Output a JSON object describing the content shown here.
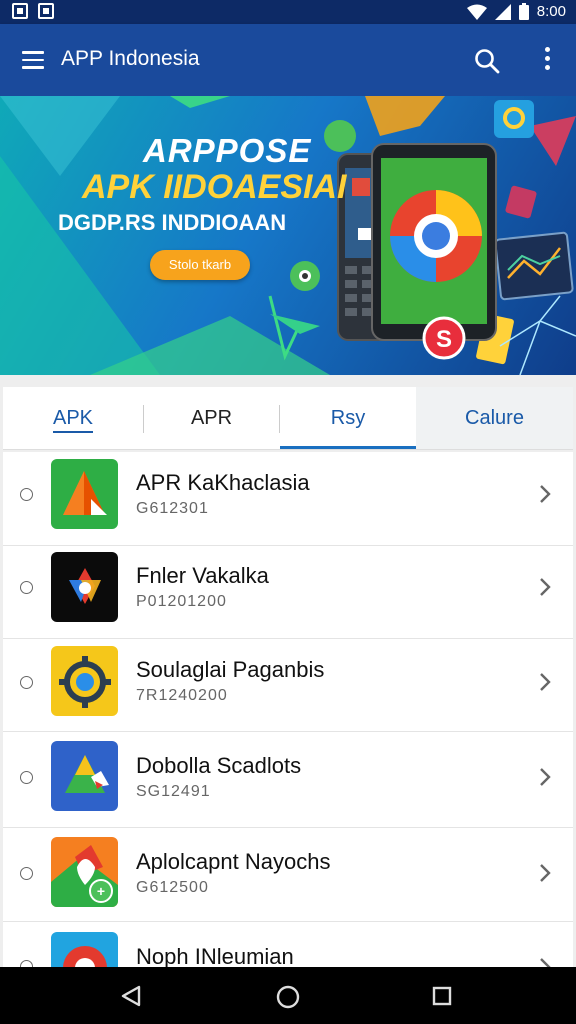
{
  "status_bar": {
    "time": "8:00"
  },
  "app_bar": {
    "title": "APP Indonesia"
  },
  "banner": {
    "line1": "ARPPOSE",
    "line2": "APK IIDOAESIAI",
    "line3": "DGDP.RS INDDIOAAN",
    "button_label": "Stolo tkarb"
  },
  "tabs": [
    {
      "label": "APK"
    },
    {
      "label": "APR"
    },
    {
      "label": "Rsy"
    },
    {
      "label": "Calure"
    }
  ],
  "apps": [
    {
      "title": "APR KaKhaclasia",
      "subtitle": "G612301"
    },
    {
      "title": "Fnler Vakalka",
      "subtitle": "P01201200"
    },
    {
      "title": "Soulaglai Paganbis",
      "subtitle": "7R1240200"
    },
    {
      "title": "Dobolla Scadlots",
      "subtitle": "SG12491"
    },
    {
      "title": "Aplolcapnt Nayochs",
      "subtitle": "G612500"
    },
    {
      "title": "Noph INleumian",
      "subtitle": ""
    }
  ],
  "colors": {
    "app_bar": "#1a4a9c",
    "accent": "#1a6fc0"
  }
}
